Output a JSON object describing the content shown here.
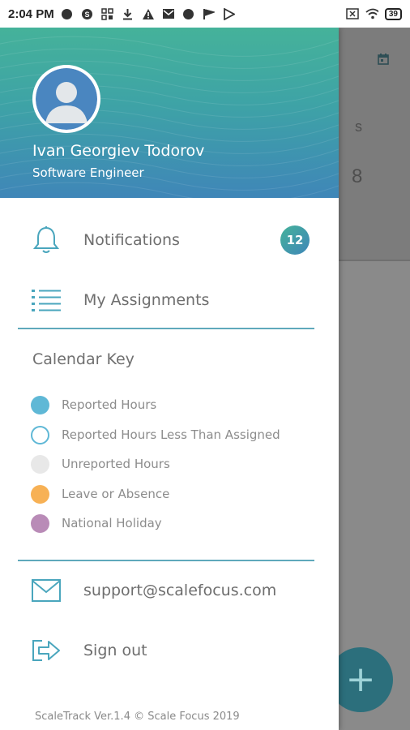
{
  "status_bar": {
    "time": "2:04 PM",
    "left_icons": [
      "circle-icon",
      "skype-icon",
      "grid-icon",
      "download-icon",
      "warning-icon",
      "mail-icon",
      "circle-icon",
      "flag-icon",
      "play-store-icon"
    ],
    "right_icons": [
      "sim-icon",
      "wifi-icon"
    ],
    "battery": "39"
  },
  "background_app": {
    "letter": "s",
    "number": "8",
    "fab_label": "+"
  },
  "drawer": {
    "user": {
      "name": "Ivan Georgiev Todorov",
      "title": "Software Engineer"
    },
    "menu": {
      "notifications_label": "Notifications",
      "notifications_count": "12",
      "assignments_label": "My Assignments"
    },
    "calendar_key": {
      "title": "Calendar Key",
      "items": [
        {
          "label": "Reported Hours",
          "color": "#5fb8d6",
          "style": "filled"
        },
        {
          "label": "Reported Hours Less Than Assigned",
          "color": "#5fb8d6",
          "style": "outline"
        },
        {
          "label": "Unreported Hours",
          "color": "#e8e8e8",
          "style": "filled"
        },
        {
          "label": "Leave or Absence",
          "color": "#f7b155",
          "style": "filled"
        },
        {
          "label": "National Holiday",
          "color": "#b98bb7",
          "style": "filled"
        }
      ]
    },
    "support_email": "support@scalefocus.com",
    "sign_out_label": "Sign out",
    "footer": "ScaleTrack Ver.1.4 © Scale Focus 2019"
  },
  "colors": {
    "accent": "#3fa0a8",
    "icon": "#4aa6bd",
    "header_top": "#45b29a",
    "header_bottom": "#3f86b8"
  }
}
